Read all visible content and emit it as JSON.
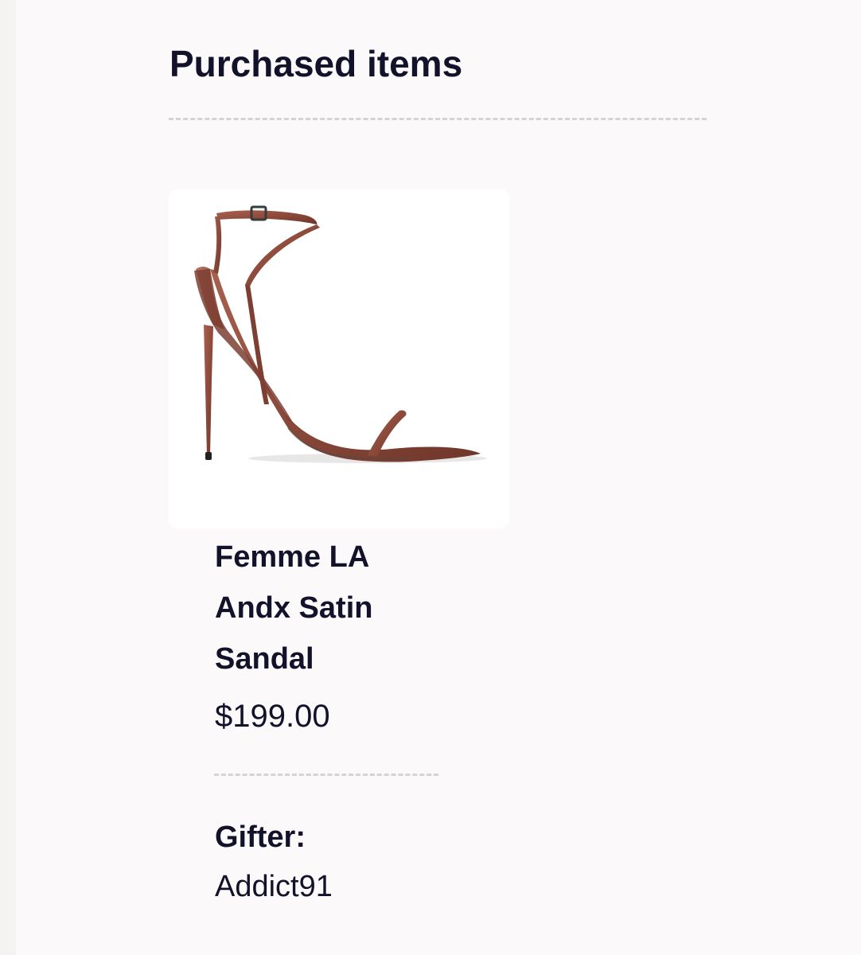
{
  "section": {
    "title": "Purchased items"
  },
  "item": {
    "name": "Femme LA Andx Satin Sandal",
    "price": "$199.00",
    "image_description": "bronze satin stiletto sandal",
    "image_color": "#8c4a3b"
  },
  "gifter": {
    "label": "Gifter:",
    "name": "Addict91"
  }
}
